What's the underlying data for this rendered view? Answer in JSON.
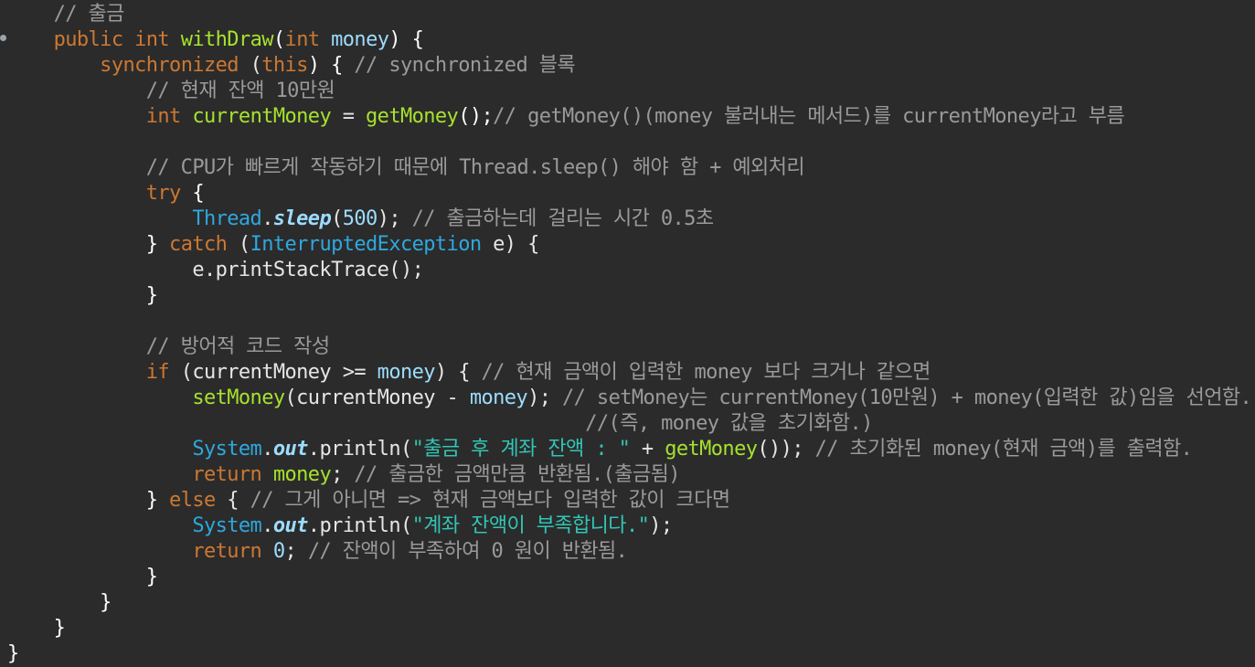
{
  "editor": {
    "language": "Java",
    "theme_colors": {
      "background": "#2b2b2b",
      "keyword": "#cc7832",
      "method": "#a6e22e",
      "variable": "#9cdcfe",
      "type": "#2ea8df",
      "comment": "#9a9a9a",
      "string": "#32c5b5"
    },
    "lines": [
      {
        "tokens": [
          {
            "t": "    "
          },
          {
            "t": "// 출금",
            "c": "comment"
          }
        ]
      },
      {
        "tokens": [
          {
            "t": "    "
          },
          {
            "t": "public",
            "c": "keyword"
          },
          {
            "t": " "
          },
          {
            "t": "int",
            "c": "keyword"
          },
          {
            "t": " "
          },
          {
            "t": "withDraw",
            "c": "method"
          },
          {
            "t": "(",
            "c": "brace"
          },
          {
            "t": "int",
            "c": "keyword"
          },
          {
            "t": " "
          },
          {
            "t": "money",
            "c": "var"
          },
          {
            "t": ") {",
            "c": "brace"
          }
        ]
      },
      {
        "tokens": [
          {
            "t": "        "
          },
          {
            "t": "synchronized",
            "c": "keyword"
          },
          {
            "t": " ("
          },
          {
            "t": "this",
            "c": "keyword"
          },
          {
            "t": ") { ",
            "c": "brace"
          },
          {
            "t": "// synchronized 블록",
            "c": "comment"
          }
        ]
      },
      {
        "tokens": [
          {
            "t": "            "
          },
          {
            "t": "// 현재 잔액 10만원",
            "c": "comment"
          }
        ]
      },
      {
        "tokens": [
          {
            "t": "            "
          },
          {
            "t": "int",
            "c": "keyword"
          },
          {
            "t": " "
          },
          {
            "t": "currentMoney",
            "c": "method"
          },
          {
            "t": " = "
          },
          {
            "t": "getMoney",
            "c": "method"
          },
          {
            "t": "();",
            "c": "brace"
          },
          {
            "t": "// getMoney()(money 불러내는 메서드)를 currentMoney라고 부름",
            "c": "comment"
          }
        ]
      },
      {
        "tokens": [
          {
            "t": ""
          }
        ]
      },
      {
        "tokens": [
          {
            "t": "            "
          },
          {
            "t": "// CPU가 빠르게 작동하기 때문에 Thread.sleep() 해야 함 + 예외처리",
            "c": "comment"
          }
        ]
      },
      {
        "tokens": [
          {
            "t": "            "
          },
          {
            "t": "try",
            "c": "keyword"
          },
          {
            "t": " {",
            "c": "brace"
          }
        ]
      },
      {
        "tokens": [
          {
            "t": "                "
          },
          {
            "t": "Thread",
            "c": "type"
          },
          {
            "t": "."
          },
          {
            "t": "sleep",
            "c": "static"
          },
          {
            "t": "("
          },
          {
            "t": "500",
            "c": "number"
          },
          {
            "t": "); "
          },
          {
            "t": "// 출금하는데 걸리는 시간 0.5초",
            "c": "comment"
          }
        ]
      },
      {
        "tokens": [
          {
            "t": "            "
          },
          {
            "t": "} ",
            "c": "brace"
          },
          {
            "t": "catch",
            "c": "keyword"
          },
          {
            "t": " ("
          },
          {
            "t": "InterruptedException",
            "c": "type"
          },
          {
            "t": " e) {"
          }
        ]
      },
      {
        "tokens": [
          {
            "t": "                "
          },
          {
            "t": "e.printStackTrace();"
          }
        ]
      },
      {
        "tokens": [
          {
            "t": "            "
          },
          {
            "t": "}",
            "c": "brace"
          }
        ]
      },
      {
        "tokens": [
          {
            "t": ""
          }
        ]
      },
      {
        "tokens": [
          {
            "t": "            "
          },
          {
            "t": "// 방어적 코드 작성",
            "c": "comment"
          }
        ]
      },
      {
        "tokens": [
          {
            "t": "            "
          },
          {
            "t": "if",
            "c": "keyword"
          },
          {
            "t": " (currentMoney >= "
          },
          {
            "t": "money",
            "c": "var"
          },
          {
            "t": ") { "
          },
          {
            "t": "// 현재 금액이 입력한 money 보다 크거나 같으면",
            "c": "comment"
          }
        ]
      },
      {
        "tokens": [
          {
            "t": "                "
          },
          {
            "t": "setMoney",
            "c": "method"
          },
          {
            "t": "(currentMoney - "
          },
          {
            "t": "money",
            "c": "var"
          },
          {
            "t": "); "
          },
          {
            "t": "// setMoney는 currentMoney(10만원) + money(입력한 값)임을 선언함.",
            "c": "comment"
          }
        ]
      },
      {
        "tokens": [
          {
            "t": "                                                  "
          },
          {
            "t": "//(즉, money 값을 초기화함.)",
            "c": "comment"
          }
        ]
      },
      {
        "tokens": [
          {
            "t": "                "
          },
          {
            "t": "System",
            "c": "type"
          },
          {
            "t": "."
          },
          {
            "t": "out",
            "c": "static"
          },
          {
            "t": ".println("
          },
          {
            "t": "\"출금 후 계좌 잔액 : \"",
            "c": "string"
          },
          {
            "t": " + "
          },
          {
            "t": "getMoney",
            "c": "method"
          },
          {
            "t": "()); "
          },
          {
            "t": "// 초기화된 money(현재 금액)를 출력함.",
            "c": "comment"
          }
        ]
      },
      {
        "tokens": [
          {
            "t": "                "
          },
          {
            "t": "return",
            "c": "keyword"
          },
          {
            "t": " "
          },
          {
            "t": "money",
            "c": "method"
          },
          {
            "t": "; "
          },
          {
            "t": "// 출금한 금액만큼 반환됨.(출금됨)",
            "c": "comment"
          }
        ]
      },
      {
        "tokens": [
          {
            "t": "            "
          },
          {
            "t": "} ",
            "c": "brace"
          },
          {
            "t": "else",
            "c": "keyword"
          },
          {
            "t": " { "
          },
          {
            "t": "// 그게 아니면 => 현재 금액보다 입력한 값이 크다면",
            "c": "comment"
          }
        ]
      },
      {
        "tokens": [
          {
            "t": "                "
          },
          {
            "t": "System",
            "c": "type"
          },
          {
            "t": "."
          },
          {
            "t": "out",
            "c": "static"
          },
          {
            "t": ".println("
          },
          {
            "t": "\"계좌 잔액이 부족합니다.\"",
            "c": "string"
          },
          {
            "t": ");"
          }
        ]
      },
      {
        "tokens": [
          {
            "t": "                "
          },
          {
            "t": "return",
            "c": "keyword"
          },
          {
            "t": " "
          },
          {
            "t": "0",
            "c": "number"
          },
          {
            "t": "; "
          },
          {
            "t": "// 잔액이 부족하여 0 원이 반환됨.",
            "c": "comment"
          }
        ]
      },
      {
        "tokens": [
          {
            "t": "            "
          },
          {
            "t": "}",
            "c": "brace"
          }
        ]
      },
      {
        "tokens": [
          {
            "t": "        "
          },
          {
            "t": "}",
            "c": "brace"
          }
        ]
      },
      {
        "tokens": [
          {
            "t": "    "
          },
          {
            "t": "}",
            "c": "brace"
          }
        ]
      },
      {
        "tokens": [
          {
            "t": "}",
            "c": "brace"
          }
        ]
      }
    ]
  }
}
